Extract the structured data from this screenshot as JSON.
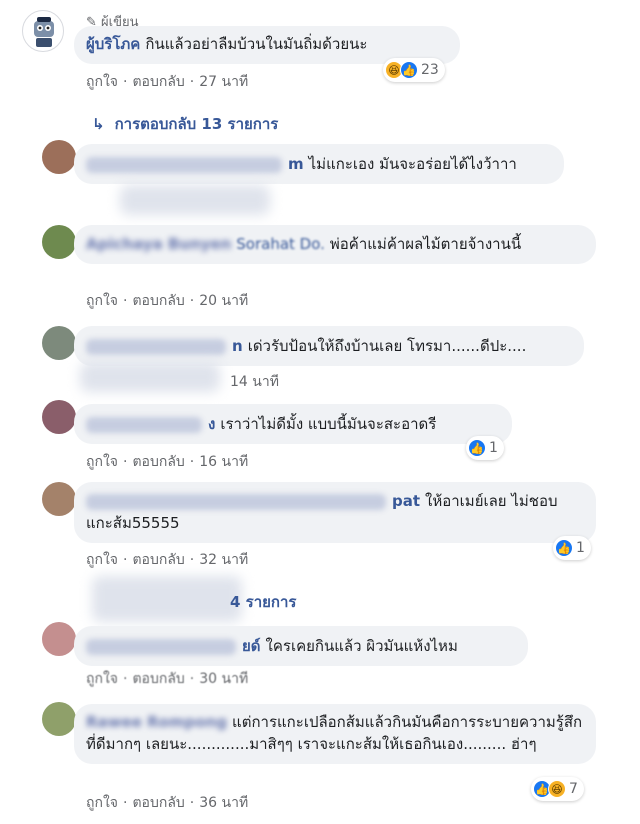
{
  "colors": {
    "bubble": "#f0f2f5",
    "link": "#385898",
    "meta": "#65676b",
    "like": "#1877f2",
    "haha": "#f7b125"
  },
  "top_comment": {
    "author_badge": "ผู้เขียน",
    "author": "ผู้บริโภค",
    "text": "กินแล้วอย่าลืมบ้วนในมันถิ่มด้วยนะ",
    "like": "ถูกใจ",
    "reply": "ตอบกลับ",
    "time": "27 นาที",
    "reactions": {
      "icons": [
        "haha-icon",
        "like-icon"
      ],
      "count": "23"
    }
  },
  "replies_link_1": "การตอบกลับ 13 รายการ",
  "comments": [
    {
      "author": "m",
      "text": "ไม่แกะเอง มันจะอร่อยได้ไงว้าาา",
      "like": "",
      "reply": "",
      "time": ""
    },
    {
      "author": "Apichaya Bunyen",
      "mention": "Sorahat Do.",
      "text": "พ่อค้าแม่ค้าผลไม้ตายจ้างานนี้",
      "like": "ถูกใจ",
      "reply": "ตอบกลับ",
      "time": "20 นาที"
    },
    {
      "author": "n",
      "text": "เด่วรับป้อนให้ถึงบ้านเลย โทรมา......ดีปะ....",
      "like": "",
      "reply": "",
      "time": "14 นาที"
    },
    {
      "author": "ง",
      "text": "เราว่าไม่ดีมั้ง แบบนี้มันจะสะอาดรี",
      "like": "ถูกใจ",
      "reply": "ตอบกลับ",
      "time": "16 นาที",
      "reaction_count": "1"
    },
    {
      "author": "pat",
      "text": "ให้อาเมย์เลย ไม่ชอบแกะส้ม55555",
      "like": "ถูกใจ",
      "reply": "ตอบกลับ",
      "time": "32 นาที",
      "reaction_count": "1"
    }
  ],
  "replies_link_2": "4 รายการ",
  "comments2": [
    {
      "author": "ยด์",
      "text": "ใครเคยกินแล้ว ผิวมันแห้งไหม",
      "like": "ถูกใจ",
      "reply": "ตอบกลับ",
      "time": "30 นาที"
    },
    {
      "author": "Rawee Rompong",
      "text": "แต่การแกะเปลือกส้มแล้วกินมันคือการระบายความรู้สึกที่ดีมากๆ เลยนะ.............มาสิๆๆ เราจะแกะส้มให้เธอกินเอง......... ฮ่าๆ",
      "like": "ถูกใจ",
      "reply": "ตอบกลับ",
      "time": "36 นาที",
      "reaction_count": "7"
    }
  ]
}
